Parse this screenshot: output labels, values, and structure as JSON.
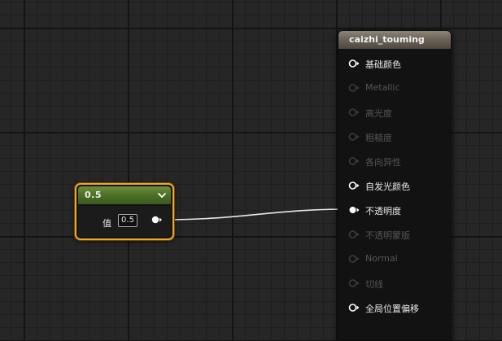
{
  "constant_node": {
    "title": "0.5",
    "value_label": "值",
    "value": "0.5"
  },
  "material_node": {
    "title": "caizhi_touming",
    "pins": [
      {
        "label": "基础颜色",
        "enabled": true,
        "connected": false
      },
      {
        "label": "Metallic",
        "enabled": false,
        "connected": false
      },
      {
        "label": "高光度",
        "enabled": false,
        "connected": false
      },
      {
        "label": "粗糙度",
        "enabled": false,
        "connected": false
      },
      {
        "label": "各向异性",
        "enabled": false,
        "connected": false
      },
      {
        "label": "自发光颜色",
        "enabled": true,
        "connected": false
      },
      {
        "label": "不透明度",
        "enabled": true,
        "connected": true
      },
      {
        "label": "不透明蒙版",
        "enabled": false,
        "connected": false
      },
      {
        "label": "Normal",
        "enabled": false,
        "connected": false
      },
      {
        "label": "切线",
        "enabled": false,
        "connected": false
      },
      {
        "label": "全局位置偏移",
        "enabled": true,
        "connected": false
      }
    ]
  },
  "icons": {
    "collapse": "chevron-down-icon",
    "pin_empty": "pin-circle-icon",
    "pin_connected": "pin-filled-icon"
  },
  "colors": {
    "selection_border": "#f2a91c",
    "constant_header": "#4c6f26",
    "material_header": "#6f675b",
    "wire": "#e8e8e8",
    "enabled_text": "#e8e8e8",
    "disabled_text": "#555555"
  }
}
